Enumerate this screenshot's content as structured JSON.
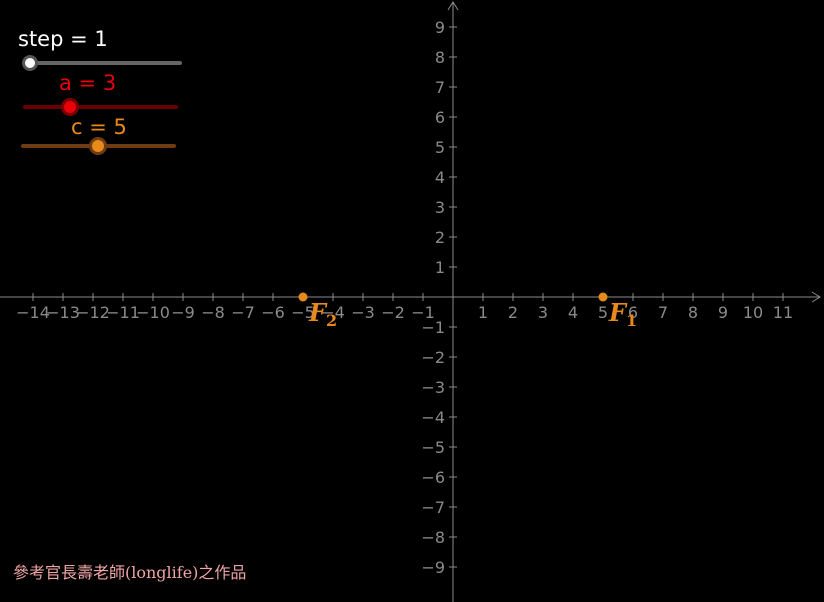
{
  "sliders": {
    "step": {
      "label": "step = 1",
      "color": "#ffffff",
      "track_color": "#666666",
      "value": 1,
      "level": 0.0
    },
    "a": {
      "label": "a = 3",
      "color": "#e8000b",
      "track_color": "#6b0000",
      "value": 3,
      "level": 0.32
    },
    "c": {
      "label": "c = 5",
      "color": "#e8891c",
      "track_color": "#6e3b12",
      "value": 5,
      "level": 0.5
    }
  },
  "axes": {
    "x_ticks": [
      "−14",
      "−13",
      "−12",
      "−11",
      "−10",
      "−9",
      "−8",
      "−7",
      "−6",
      "−5",
      "−4",
      "−3",
      "−2",
      "−1",
      "1",
      "2",
      "3",
      "4",
      "5",
      "6",
      "7",
      "8",
      "9",
      "10",
      "11"
    ],
    "x_tick_values": [
      -14,
      -13,
      -12,
      -11,
      -10,
      -9,
      -8,
      -7,
      -6,
      -5,
      -4,
      -3,
      -2,
      -1,
      1,
      2,
      3,
      4,
      5,
      6,
      7,
      8,
      9,
      10,
      11
    ],
    "y_ticks": [
      "9",
      "8",
      "7",
      "6",
      "5",
      "4",
      "3",
      "2",
      "1",
      "−1",
      "−2",
      "−3",
      "−4",
      "−5",
      "−6",
      "−7",
      "−8",
      "−9"
    ],
    "y_tick_values": [
      9,
      8,
      7,
      6,
      5,
      4,
      3,
      2,
      1,
      -1,
      -2,
      -3,
      -4,
      -5,
      -6,
      -7,
      -8,
      -9
    ],
    "axis_color": "#8a8a8a"
  },
  "points": {
    "F1": {
      "name": "F",
      "sub": "1",
      "x": 5,
      "y": 0
    },
    "F2": {
      "name": "F",
      "sub": "2",
      "x": -5,
      "y": 0
    }
  },
  "point_color": "#e8891c",
  "credit": "參考官長壽老師(longlife)之作品"
}
